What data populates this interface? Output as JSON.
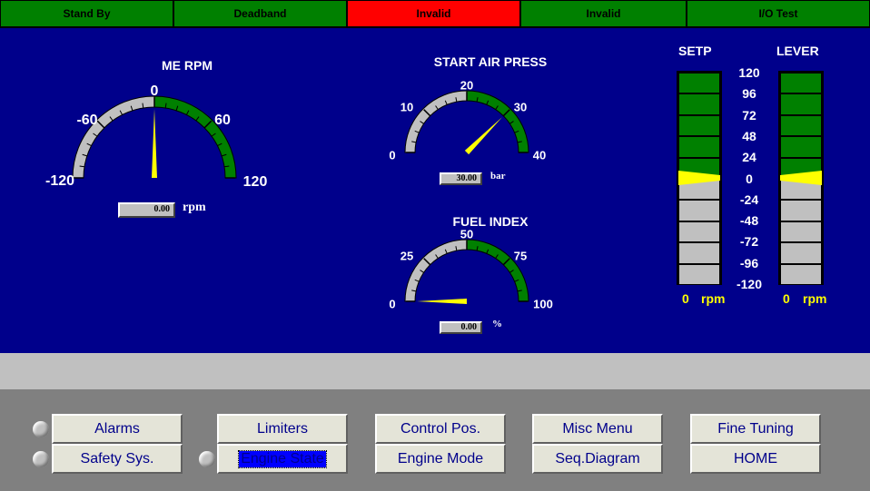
{
  "status_bar": [
    {
      "label": "Stand By",
      "bg": "#008000"
    },
    {
      "label": "Deadband",
      "bg": "#008000"
    },
    {
      "label": "Invalid",
      "bg": "#ff0000"
    },
    {
      "label": "Invalid",
      "bg": "#008000"
    },
    {
      "label": "I/O Test",
      "bg": "#008000"
    }
  ],
  "me_rpm": {
    "title": "ME RPM",
    "ticks": [
      "-120",
      "-60",
      "0",
      "60",
      "120"
    ],
    "readout": "0.00",
    "unit": "rpm",
    "value": 0
  },
  "start_air": {
    "title": "START AIR PRESS",
    "ticks": [
      "0",
      "10",
      "20",
      "30",
      "40"
    ],
    "readout": "30.00",
    "unit": "bar",
    "value": 30
  },
  "fuel_index": {
    "title": "FUEL INDEX",
    "ticks": [
      "0",
      "25",
      "50",
      "75",
      "100"
    ],
    "readout": "0.00",
    "unit": "%",
    "value": 0
  },
  "setp": {
    "title": "SETP",
    "value": "0",
    "unit": "rpm"
  },
  "lever": {
    "title": "LEVER",
    "value": "0",
    "unit": "rpm"
  },
  "bar_scale": [
    "120",
    "96",
    "72",
    "48",
    "24",
    "0",
    "-24",
    "-48",
    "-72",
    "-96",
    "-120"
  ],
  "buttons": {
    "alarms": "Alarms",
    "safety": "Safety Sys.",
    "limiters": "Limiters",
    "engine_state": "Engine State",
    "control_pos": "Control Pos.",
    "engine_mode": "Engine Mode",
    "misc_menu": "Misc Menu",
    "seq_diagram": "Seq.Diagram",
    "fine_tuning": "Fine Tuning",
    "home": "HOME"
  },
  "colors": {
    "gauge_green": "#008000",
    "gauge_gray": "#c0c0c0",
    "needle": "#ffff00",
    "panel_blue": "#00008b"
  }
}
